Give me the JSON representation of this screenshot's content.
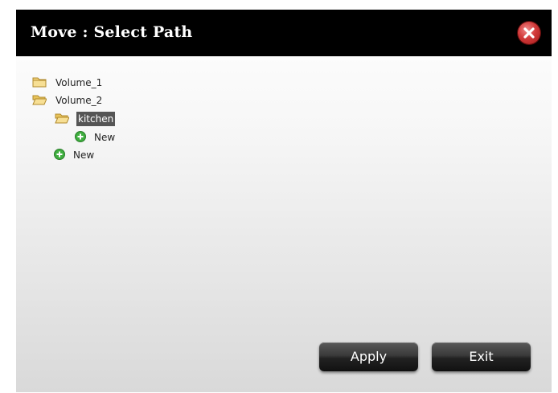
{
  "dialog": {
    "title": "Move : Select Path",
    "close_icon": "close-icon",
    "tree": {
      "items": [
        {
          "label": "Volume_1",
          "icon": "folder-icon",
          "selected": false
        },
        {
          "label": "Volume_2",
          "icon": "folder-open-icon",
          "selected": false
        },
        {
          "label": "kitchen",
          "icon": "folder-open-icon",
          "selected": true
        },
        {
          "label": "New",
          "icon": "add-icon",
          "selected": false
        },
        {
          "label": "New",
          "icon": "add-icon",
          "selected": false
        }
      ]
    },
    "buttons": {
      "apply_label": "Apply",
      "exit_label": "Exit"
    }
  },
  "colors": {
    "titlebar": "#000000",
    "selection": "#555555",
    "close_button": "#d23a3a",
    "add_icon": "#3fae3f",
    "folder": "#e8c35a"
  }
}
